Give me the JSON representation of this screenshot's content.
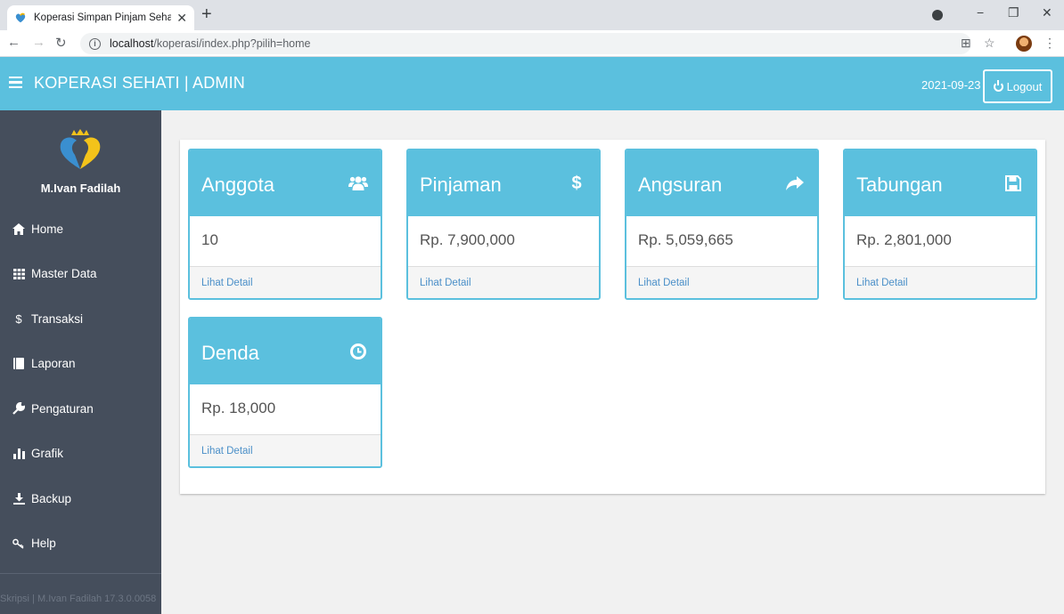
{
  "browser": {
    "tab_title": "Koperasi Simpan Pinjam Sehati M",
    "url_host": "localhost",
    "url_path": "/koperasi/index.php?pilih=home"
  },
  "header": {
    "brand": "KOPERASI SEHATI | ADMIN",
    "date": "2021-09-23",
    "logout_label": "Logout",
    "accent_color": "#5bc0de"
  },
  "sidebar": {
    "user_name": "M.Ivan Fadilah",
    "items": [
      {
        "label": "Home",
        "icon": "home-icon"
      },
      {
        "label": "Master Data",
        "icon": "grid-icon"
      },
      {
        "label": "Transaksi",
        "icon": "dollar-icon"
      },
      {
        "label": "Laporan",
        "icon": "book-icon"
      },
      {
        "label": "Pengaturan",
        "icon": "wrench-icon"
      },
      {
        "label": "Grafik",
        "icon": "bar-chart-icon"
      },
      {
        "label": "Backup",
        "icon": "download-icon"
      },
      {
        "label": "Help",
        "icon": "key-icon"
      }
    ],
    "footer": "Skripsi | M.Ivan Fadilah 17.3.0.0058"
  },
  "cards": [
    {
      "title": "Anggota",
      "value": "10",
      "link": "Lihat Detail",
      "icon": "users-icon"
    },
    {
      "title": "Pinjaman",
      "value": "Rp. 7,900,000",
      "link": "Lihat Detail",
      "icon": "dollar-icon"
    },
    {
      "title": "Angsuran",
      "value": "Rp. 5,059,665",
      "link": "Lihat Detail",
      "icon": "share-icon"
    },
    {
      "title": "Tabungan",
      "value": "Rp. 2,801,000",
      "link": "Lihat Detail",
      "icon": "save-icon"
    },
    {
      "title": "Denda",
      "value": "Rp. 18,000",
      "link": "Lihat Detail",
      "icon": "clock-icon"
    }
  ]
}
